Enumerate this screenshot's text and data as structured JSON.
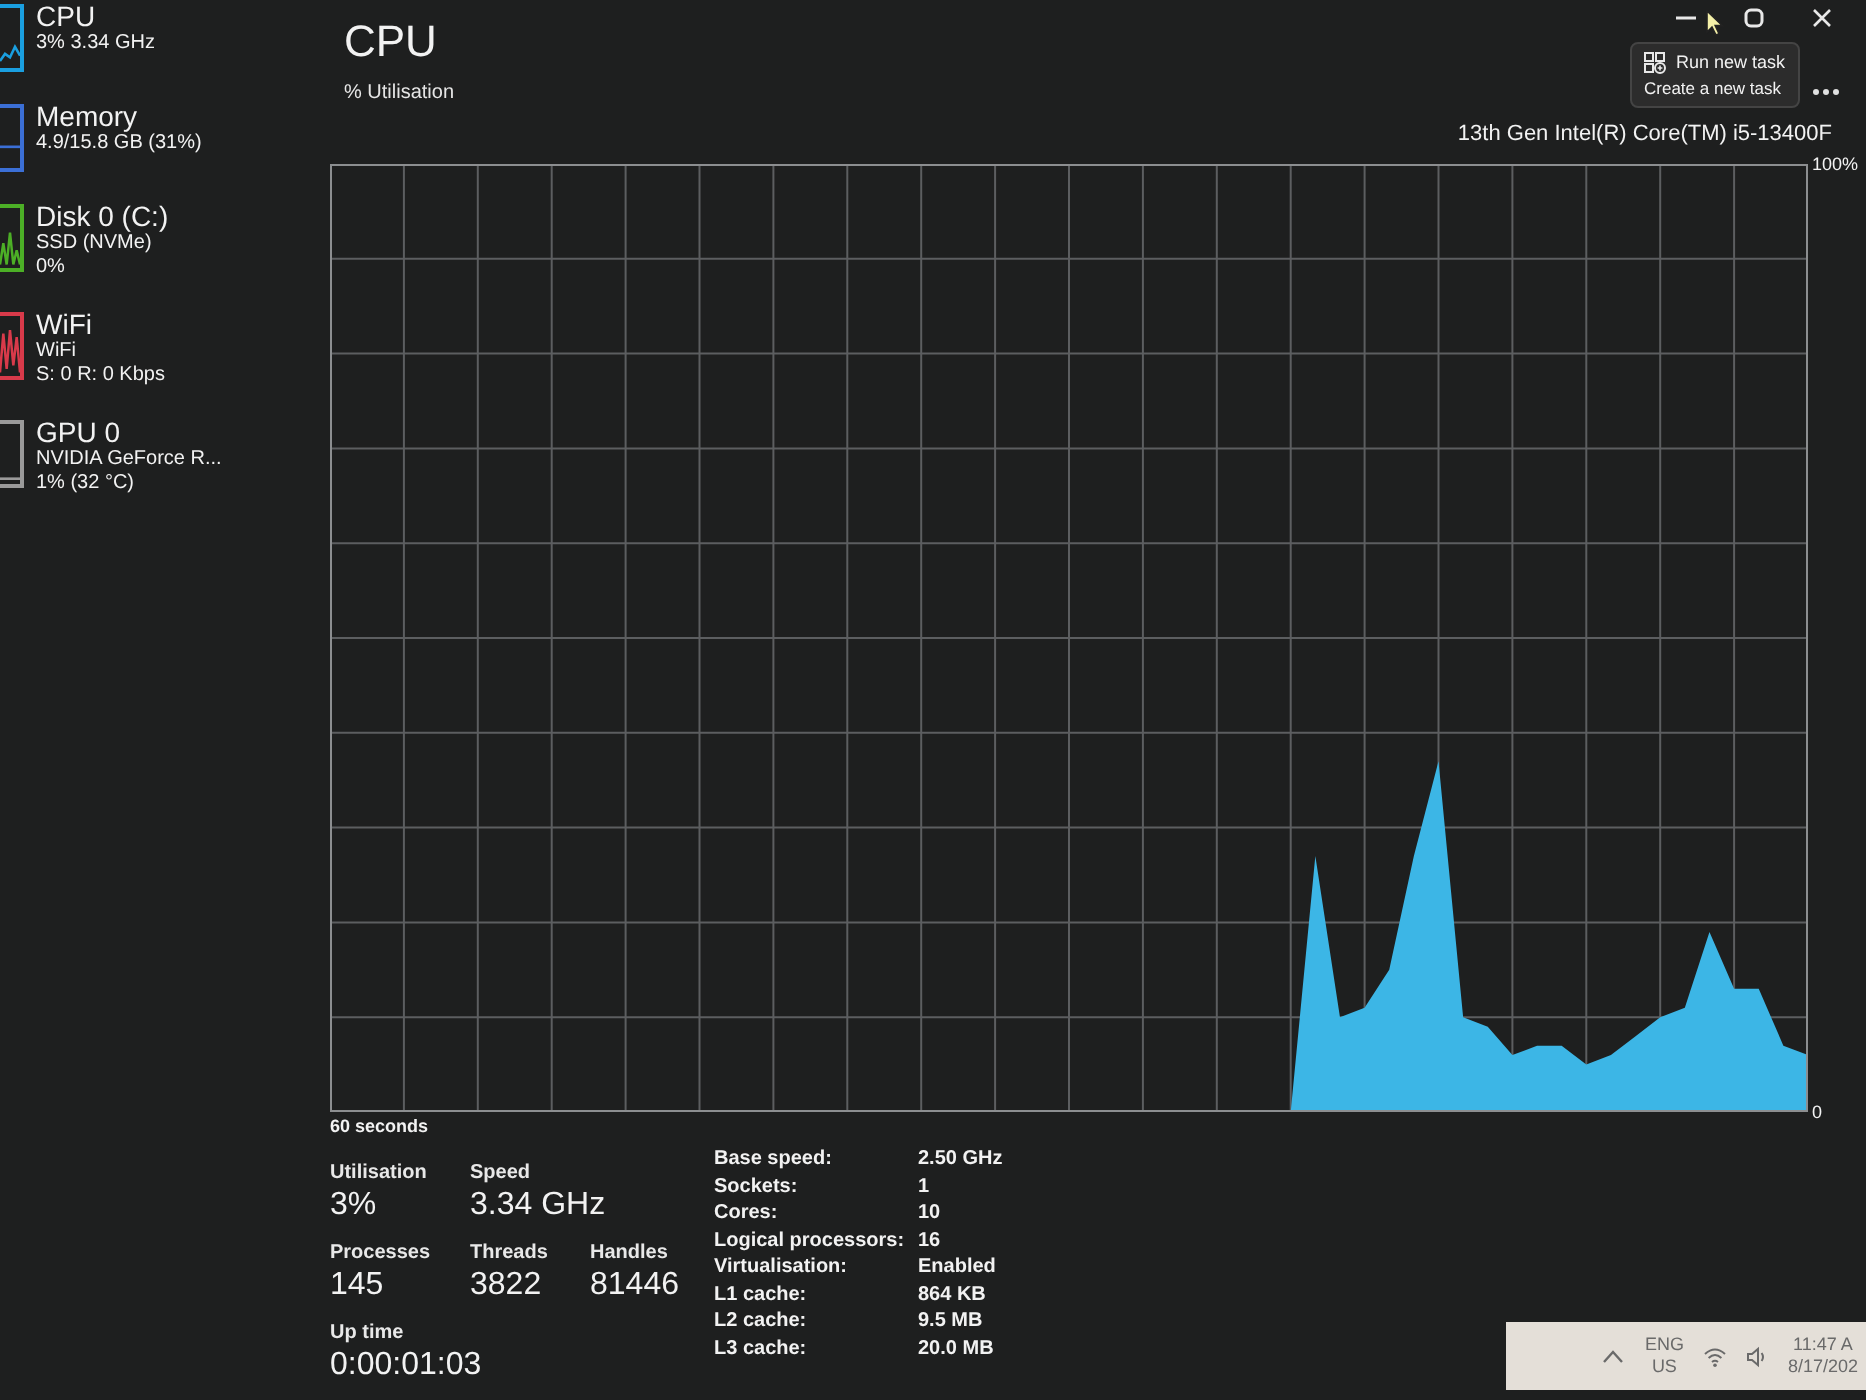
{
  "sidebar": {
    "items": [
      {
        "title": "CPU",
        "lines": [
          "3% 3.34 GHz"
        ],
        "color": "#1a9fe0"
      },
      {
        "title": "Memory",
        "lines": [
          "4.9/15.8 GB (31%)"
        ],
        "color": "#3b6fd6"
      },
      {
        "title": "Disk 0 (C:)",
        "lines": [
          "SSD (NVMe)",
          "0%"
        ],
        "color": "#4caf26"
      },
      {
        "title": "WiFi",
        "lines": [
          "WiFi",
          "S: 0 R: 0 Kbps"
        ],
        "color": "#d83a4a"
      },
      {
        "title": "GPU 0",
        "lines": [
          "NVIDIA GeForce R...",
          "1% (32 °C)"
        ],
        "color": "#9a9a9a"
      }
    ]
  },
  "header": {
    "title": "CPU",
    "processor": "13th Gen Intel(R) Core(TM) i5-13400F"
  },
  "tooltip": {
    "title": "Run new task",
    "description": "Create a new task"
  },
  "graph": {
    "chart_data": {
      "type": "area",
      "ylabel": "% Utilisation",
      "xlabel": "60 seconds",
      "categories": [
        null,
        null,
        null,
        null,
        null,
        null,
        null,
        null,
        null,
        null,
        null,
        null,
        null,
        null,
        null,
        null,
        null,
        null,
        null,
        null,
        null,
        null,
        null,
        null,
        null,
        null,
        null,
        null,
        null,
        null,
        null,
        null,
        null,
        null,
        null,
        null,
        null,
        null,
        null,
        null,
        null,
        null,
        null,
        null,
        null,
        null,
        null,
        null,
        null,
        null,
        null,
        null,
        null,
        null,
        null,
        null,
        null,
        null,
        null,
        null,
        null
      ],
      "values": [
        null,
        null,
        null,
        null,
        null,
        null,
        null,
        null,
        null,
        null,
        null,
        null,
        null,
        null,
        null,
        null,
        null,
        null,
        null,
        null,
        null,
        null,
        null,
        null,
        null,
        null,
        null,
        null,
        null,
        null,
        null,
        null,
        null,
        null,
        null,
        null,
        null,
        null,
        null,
        0,
        27,
        10,
        11,
        15,
        27,
        37,
        10,
        9,
        6,
        7,
        7,
        5,
        6,
        8,
        10,
        11,
        19,
        13,
        13,
        7,
        6
      ],
      "ylim": [
        0,
        100
      ],
      "yticks": [
        {
          "value": 0,
          "label": "0"
        },
        {
          "value": 100,
          "label": "100%"
        }
      ],
      "grid": true
    }
  },
  "stats": {
    "rows": [
      [
        {
          "label": "Utilisation",
          "value": "3%"
        },
        {
          "label": "Speed",
          "value": "3.34 GHz"
        }
      ],
      [
        {
          "label": "Processes",
          "value": "145"
        },
        {
          "label": "Threads",
          "value": "3822"
        },
        {
          "label": "Handles",
          "value": "81446"
        }
      ],
      [
        {
          "label": "Up time",
          "value": "0:00:01:03"
        }
      ]
    ],
    "details": [
      {
        "label": "Base speed:",
        "value": "2.50 GHz"
      },
      {
        "label": "Sockets:",
        "value": "1"
      },
      {
        "label": "Cores:",
        "value": "10"
      },
      {
        "label": "Logical processors:",
        "value": "16"
      },
      {
        "label": "Virtualisation:",
        "value": "Enabled"
      },
      {
        "label": "L1 cache:",
        "value": "864 KB"
      },
      {
        "label": "L2 cache:",
        "value": "9.5 MB"
      },
      {
        "label": "L3 cache:",
        "value": "20.0 MB"
      }
    ]
  },
  "taskbar": {
    "language": "ENG",
    "region": "US",
    "time": "11:47 A",
    "date": "8/17/202"
  }
}
